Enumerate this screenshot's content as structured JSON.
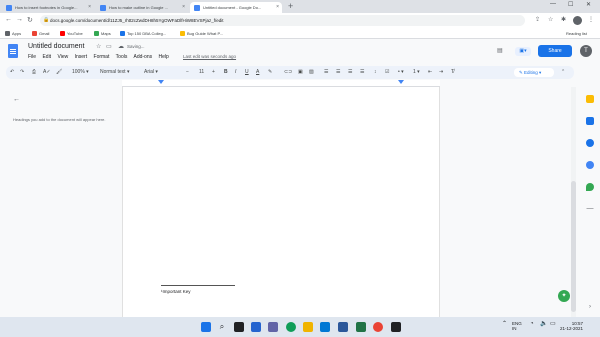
{
  "tabs": [
    {
      "label": "How to insert footnotes in Google..."
    },
    {
      "label": "How to make outline in Google ..."
    },
    {
      "label": "Untitled document - Google Do..."
    }
  ],
  "address": {
    "url": "docs.google.com/document/d/11ZJ5_rhtt2cZwdDH8h5YgOWFaDlfHiW8EVSPjaz_f/edit"
  },
  "bookmarks": [
    {
      "label": "Apps",
      "color": "#5f6368"
    },
    {
      "label": "Gmail",
      "color": "#ea4335"
    },
    {
      "label": "YouTube",
      "color": "#ff0000"
    },
    {
      "label": "Maps",
      "color": "#34a853"
    },
    {
      "label": "Top 150 DBA Colleg...",
      "color": "#1a73e8"
    },
    {
      "label": "Bug Guide What P...",
      "color": "#fbbc04"
    }
  ],
  "reading_list": "Reading list",
  "doc": {
    "title": "Untitled document",
    "saving": "Saving...",
    "menus": [
      "File",
      "Edit",
      "View",
      "Insert",
      "Format",
      "Tools",
      "Add-ons",
      "Help"
    ],
    "last_edit": "Last edit was seconds ago",
    "share": "Share",
    "avatar_letter": "T"
  },
  "toolbar": {
    "zoom": "100%",
    "style": "Normal text",
    "font": "Arial",
    "font_size": "11",
    "mode": "Editing"
  },
  "outline": {
    "hint": "Headings you add to the document will appear here."
  },
  "footnote": {
    "text": "¹Important Key"
  },
  "tray": {
    "lang": "ENG",
    "region": "IN",
    "time": "10:57",
    "date": "21-12-2021"
  }
}
